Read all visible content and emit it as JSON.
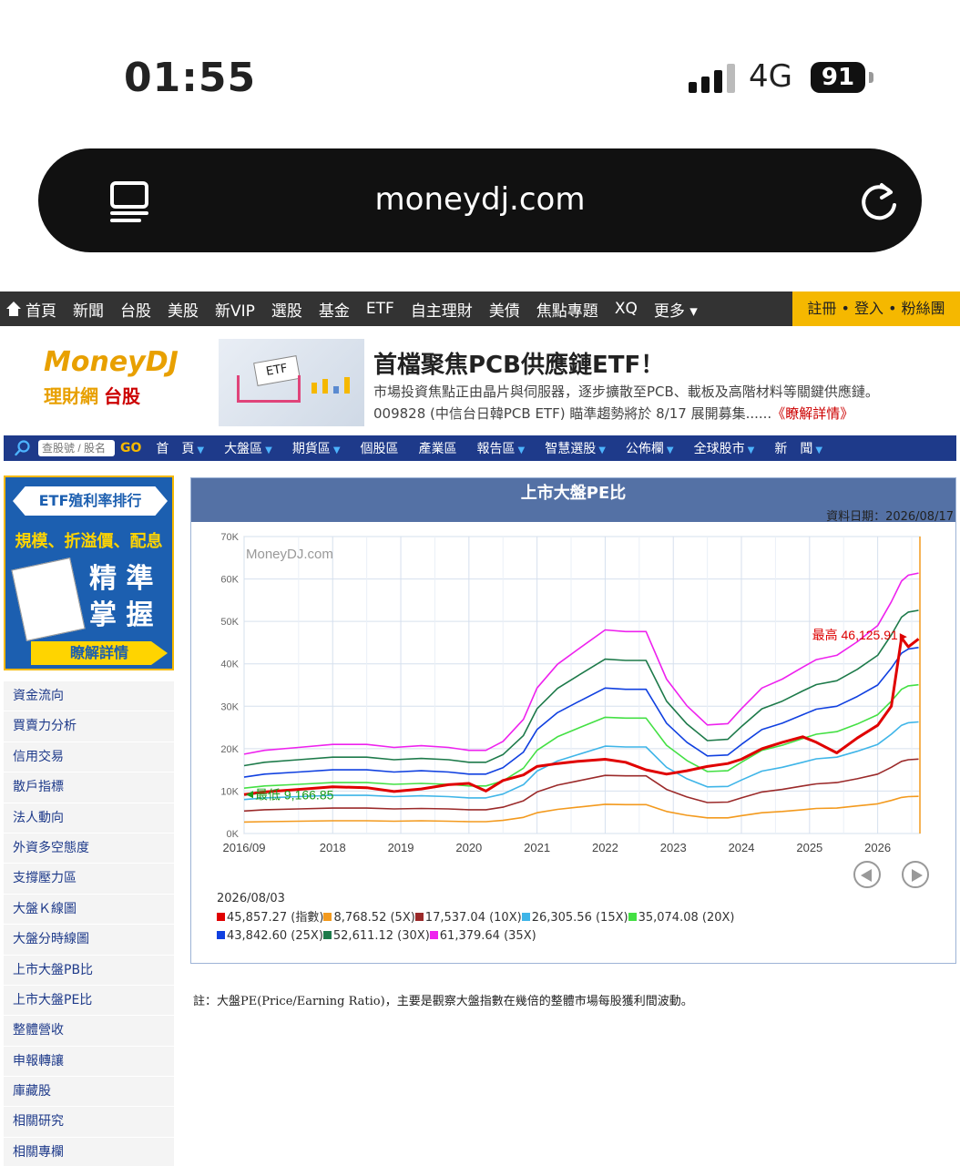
{
  "status": {
    "time": "01:55",
    "network": "4G",
    "battery": "91"
  },
  "browser": {
    "url": "moneydj.com"
  },
  "topnav": {
    "items": [
      "首頁",
      "新聞",
      "台股",
      "美股",
      "新VIP",
      "選股",
      "基金",
      "ETF",
      "自主理財",
      "美債",
      "焦點專題",
      "XQ",
      "更多"
    ],
    "account": "註冊 • 登入 • 粉絲團"
  },
  "logo": {
    "brand": "MoneyDJ",
    "sub": "理財網",
    "section": "台股"
  },
  "banner": {
    "image_tag": "ETF",
    "title": "首檔聚焦PCB供應鏈ETF！",
    "line1": "市場投資焦點正由晶片與伺服器，逐步擴散至PCB、載板及高階材料等關鍵供應鏈。",
    "line2": "009828 (中信台日韓PCB ETF) 瞄準趨勢將於 8/17 展開募集......",
    "link": "《瞭解詳情》"
  },
  "bluenav": {
    "search_placeholder": "查股號 / 股名",
    "go": "GO",
    "items": [
      "首　頁",
      "大盤區",
      "期貨區",
      "個股區",
      "產業區",
      "報告區",
      "智慧選股",
      "公佈欄",
      "全球股市",
      "新　聞"
    ]
  },
  "promo": {
    "title": "ETF殖利率排行",
    "sub": "規模、折溢價、配息",
    "big1": "精 準",
    "big2": "掌 握",
    "button": "瞭解詳情"
  },
  "sidemenu": [
    "資金流向",
    "買賣力分析",
    "信用交易",
    "散戶指標",
    "法人動向",
    "外資多空態度",
    "支撐壓力區",
    "大盤Ｋ線圖",
    "大盤分時線圖",
    "上市大盤PB比",
    "上市大盤PE比",
    "整體營收",
    "申報轉讓",
    "庫藏股",
    "相關研究",
    "相關專欄"
  ],
  "chart_panel": {
    "title": "上市大盤PE比",
    "data_date": "資料日期：2026/08/17",
    "watermark": "MoneyDJ.com",
    "legend_date": "2026/08/03",
    "max_label": "最高 46,125.91",
    "min_label": "最低 9,166.85",
    "legend": [
      {
        "text": "45,857.27 (指數)",
        "color": "#e00000"
      },
      {
        "text": "8,768.52 (5X)",
        "color": "#f39a1e"
      },
      {
        "text": "17,537.04 (10X)",
        "color": "#9b2a2a"
      },
      {
        "text": "26,305.56 (15X)",
        "color": "#3fb5e8"
      },
      {
        "text": "35,074.08 (20X)",
        "color": "#44e044"
      },
      {
        "text": "43,842.60 (25X)",
        "color": "#1040e0"
      },
      {
        "text": "52,611.12 (30X)",
        "color": "#1d7a4a"
      },
      {
        "text": "61,379.64 (35X)",
        "color": "#ee22ee"
      }
    ]
  },
  "chart_data": {
    "type": "line",
    "y_ticks": [
      "70K",
      "60K",
      "50K",
      "40K",
      "30K",
      "20K",
      "10K",
      "0K"
    ],
    "ylim": [
      0,
      70000
    ],
    "x_ticks": [
      "2016/09",
      "2018",
      "2019",
      "2020",
      "2021",
      "2022",
      "2023",
      "2024",
      "2025",
      "2026"
    ],
    "x": [
      2016.7,
      2017.0,
      2017.5,
      2018.0,
      2018.5,
      2018.9,
      2019.3,
      2019.7,
      2020.0,
      2020.25,
      2020.5,
      2020.8,
      2021.0,
      2021.3,
      2021.6,
      2022.0,
      2022.3,
      2022.6,
      2022.9,
      2023.2,
      2023.5,
      2023.8,
      2024.0,
      2024.3,
      2024.6,
      2024.9,
      2025.1,
      2025.4,
      2025.7,
      2026.0,
      2026.2,
      2026.35,
      2026.45,
      2026.6
    ],
    "series": [
      {
        "name": "指數",
        "color": "#e00000",
        "values": [
          9167,
          9800,
          10400,
          11000,
          10800,
          9900,
          10500,
          11500,
          11800,
          10000,
          12500,
          13800,
          15800,
          16500,
          17000,
          17500,
          16800,
          15000,
          14000,
          14800,
          15800,
          16500,
          17500,
          20000,
          21500,
          22800,
          21500,
          19000,
          22500,
          25500,
          30000,
          46126,
          44000,
          45857
        ]
      },
      {
        "name": "5X",
        "color": "#f39a1e",
        "values": [
          2700,
          2800,
          2900,
          3000,
          3000,
          2900,
          3000,
          2900,
          2800,
          2800,
          3100,
          3800,
          4900,
          5700,
          6200,
          6900,
          6800,
          6800,
          5200,
          4300,
          3700,
          3700,
          4200,
          4900,
          5200,
          5600,
          5900,
          6000,
          6500,
          7000,
          7800,
          8500,
          8700,
          8769
        ]
      },
      {
        "name": "10X",
        "color": "#9b2a2a",
        "values": [
          5300,
          5600,
          5800,
          6000,
          6000,
          5800,
          5900,
          5800,
          5600,
          5600,
          6200,
          7700,
          9800,
          11400,
          12400,
          13700,
          13600,
          13600,
          10400,
          8600,
          7300,
          7400,
          8400,
          9800,
          10400,
          11200,
          11700,
          12000,
          12900,
          14000,
          15600,
          17000,
          17400,
          17537
        ]
      },
      {
        "name": "15X",
        "color": "#3fb5e8",
        "values": [
          8000,
          8400,
          8700,
          9000,
          9000,
          8700,
          8900,
          8700,
          8400,
          8400,
          9300,
          11500,
          14700,
          17100,
          18600,
          20600,
          20400,
          20400,
          15600,
          12900,
          11000,
          11100,
          12600,
          14700,
          15600,
          16800,
          17600,
          18000,
          19400,
          21000,
          23400,
          25500,
          26100,
          26306
        ]
      },
      {
        "name": "20X",
        "color": "#44e044",
        "values": [
          10700,
          11200,
          11600,
          12000,
          12000,
          11600,
          11800,
          11600,
          11200,
          11200,
          12400,
          15400,
          19600,
          22800,
          24800,
          27400,
          27200,
          27200,
          20800,
          17200,
          14600,
          14800,
          16800,
          19600,
          20800,
          22400,
          23400,
          24000,
          25800,
          28000,
          31200,
          34000,
          34800,
          35074
        ]
      },
      {
        "name": "25X",
        "color": "#1040e0",
        "values": [
          13300,
          14000,
          14500,
          15000,
          15000,
          14500,
          14800,
          14500,
          14000,
          14000,
          15500,
          19200,
          24500,
          28500,
          31000,
          34300,
          34000,
          34000,
          26000,
          21500,
          18300,
          18500,
          21000,
          24500,
          26000,
          28000,
          29300,
          30000,
          32300,
          35000,
          39000,
          42500,
          43500,
          43843
        ]
      },
      {
        "name": "30X",
        "color": "#1d7a4a",
        "values": [
          16000,
          16800,
          17400,
          18000,
          18000,
          17400,
          17700,
          17400,
          16800,
          16800,
          18600,
          23100,
          29400,
          34200,
          37200,
          41100,
          40800,
          40800,
          31200,
          25800,
          21900,
          22200,
          25200,
          29400,
          31200,
          33600,
          35100,
          36000,
          38700,
          42000,
          46800,
          51000,
          52200,
          52611
        ]
      },
      {
        "name": "35X",
        "color": "#ee22ee",
        "values": [
          18700,
          19600,
          20300,
          21000,
          21000,
          20300,
          20700,
          20300,
          19600,
          19600,
          21700,
          26900,
          34300,
          39900,
          43400,
          48000,
          47600,
          47600,
          36400,
          30100,
          25600,
          25900,
          29400,
          34300,
          36400,
          39200,
          41000,
          42000,
          45200,
          49000,
          54600,
          59500,
          60900,
          61380
        ]
      }
    ]
  },
  "note": "註：大盤PE(Price/Earning Ratio)，主要是觀察大盤指數在幾倍的整體市場每股獲利間波動。"
}
